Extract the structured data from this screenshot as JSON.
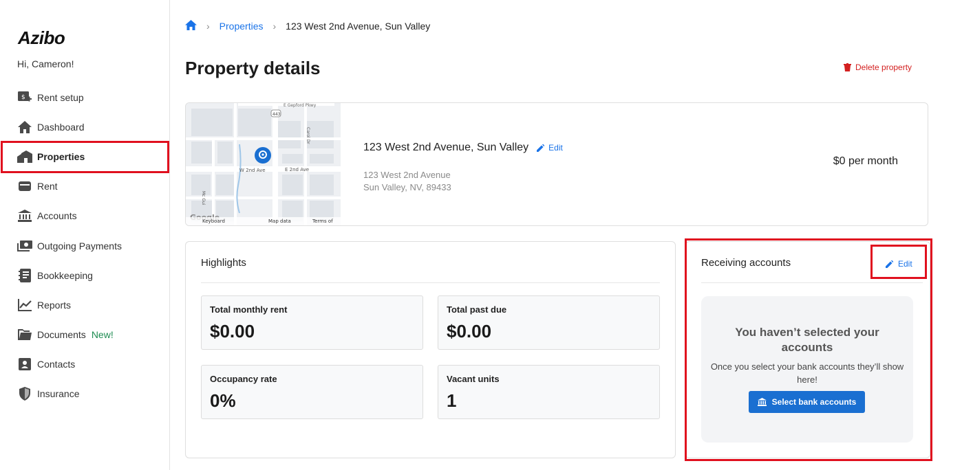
{
  "app": {
    "logo": "Azibo",
    "greeting": "Hi, Cameron!"
  },
  "sidebar": {
    "items": [
      {
        "label": "Rent setup",
        "icon": "rent-setup-icon"
      },
      {
        "label": "Dashboard",
        "icon": "home-icon"
      },
      {
        "label": "Properties",
        "icon": "properties-icon",
        "active": true
      },
      {
        "label": "Rent",
        "icon": "rent-card-icon"
      },
      {
        "label": "Accounts",
        "icon": "bank-icon"
      },
      {
        "label": "Outgoing Payments",
        "icon": "payments-icon"
      },
      {
        "label": "Bookkeeping",
        "icon": "book-icon"
      },
      {
        "label": "Reports",
        "icon": "reports-icon"
      },
      {
        "label": "Documents",
        "icon": "folder-icon",
        "badge": "New!"
      },
      {
        "label": "Contacts",
        "icon": "contacts-icon"
      },
      {
        "label": "Insurance",
        "icon": "shield-icon"
      }
    ]
  },
  "breadcrumb": {
    "home_icon": "home-icon",
    "items": [
      "Properties",
      "123 West 2nd Avenue, Sun Valley"
    ]
  },
  "page": {
    "title": "Property details",
    "delete_label": "Delete property"
  },
  "property": {
    "name": "123 West 2nd Avenue, Sun Valley",
    "edit_label": "Edit",
    "address_line1": "123 West 2nd Avenue",
    "address_line2": "Sun Valley, NV, 89433",
    "rent": "$0 per month",
    "map": {
      "labels": [
        "E Gepford Pkwy",
        "443",
        "Carol Dr",
        "W 2nd Ave",
        "E 2nd Ave",
        "Mc Gui",
        "Google",
        "Keyboard",
        "Map data",
        "Terms of"
      ]
    }
  },
  "highlights": {
    "title": "Highlights",
    "stats": [
      {
        "label": "Total monthly rent",
        "value": "$0.00"
      },
      {
        "label": "Total past due",
        "value": "$0.00"
      },
      {
        "label": "Occupancy rate",
        "value": "0%"
      },
      {
        "label": "Vacant units",
        "value": "1"
      }
    ]
  },
  "receiving": {
    "title": "Receiving accounts",
    "edit_label": "Edit",
    "empty_title": "You haven’t selected your accounts",
    "empty_desc": "Once you select your bank accounts they’ll show here!",
    "button_label": "Select bank accounts"
  },
  "colors": {
    "accent": "#1a73e8",
    "button": "#1a6fd1",
    "danger": "#d32020",
    "highlight": "#e0101e",
    "new_badge": "#1e8c52"
  }
}
